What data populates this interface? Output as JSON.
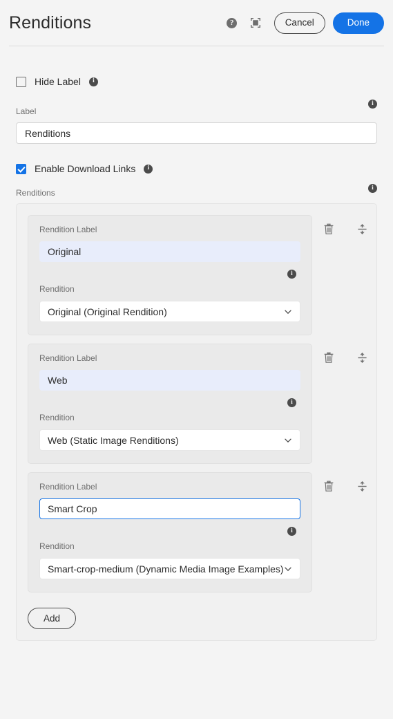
{
  "header": {
    "title": "Renditions",
    "help_icon": "help-icon",
    "fullscreen_icon": "fullscreen-icon",
    "cancel_label": "Cancel",
    "done_label": "Done",
    "accent_color": "#1473E6"
  },
  "form": {
    "hide_label_checkbox": {
      "label": "Hide Label",
      "checked": false
    },
    "label_field": {
      "label": "Label",
      "value": "Renditions"
    },
    "enable_download_checkbox": {
      "label": "Enable Download Links",
      "checked": true
    },
    "renditions_section_label": "Renditions",
    "info_icon": "info-icon"
  },
  "renditions": [
    {
      "label_field_label": "Rendition Label",
      "label_value": "Original",
      "focused": false,
      "rendition_field_label": "Rendition",
      "rendition_value": "Original (Original Rendition)",
      "delete_icon": "trash-icon",
      "reorder_icon": "reorder-handle-icon"
    },
    {
      "label_field_label": "Rendition Label",
      "label_value": "Web",
      "focused": false,
      "rendition_field_label": "Rendition",
      "rendition_value": "Web (Static Image Renditions)",
      "delete_icon": "trash-icon",
      "reorder_icon": "reorder-handle-icon"
    },
    {
      "label_field_label": "Rendition Label",
      "label_value": "Smart Crop",
      "focused": true,
      "rendition_field_label": "Rendition",
      "rendition_value": "Smart-crop-medium (Dynamic Media Image Examples)",
      "delete_icon": "trash-icon",
      "reorder_icon": "reorder-handle-icon"
    }
  ],
  "add_button_label": "Add"
}
